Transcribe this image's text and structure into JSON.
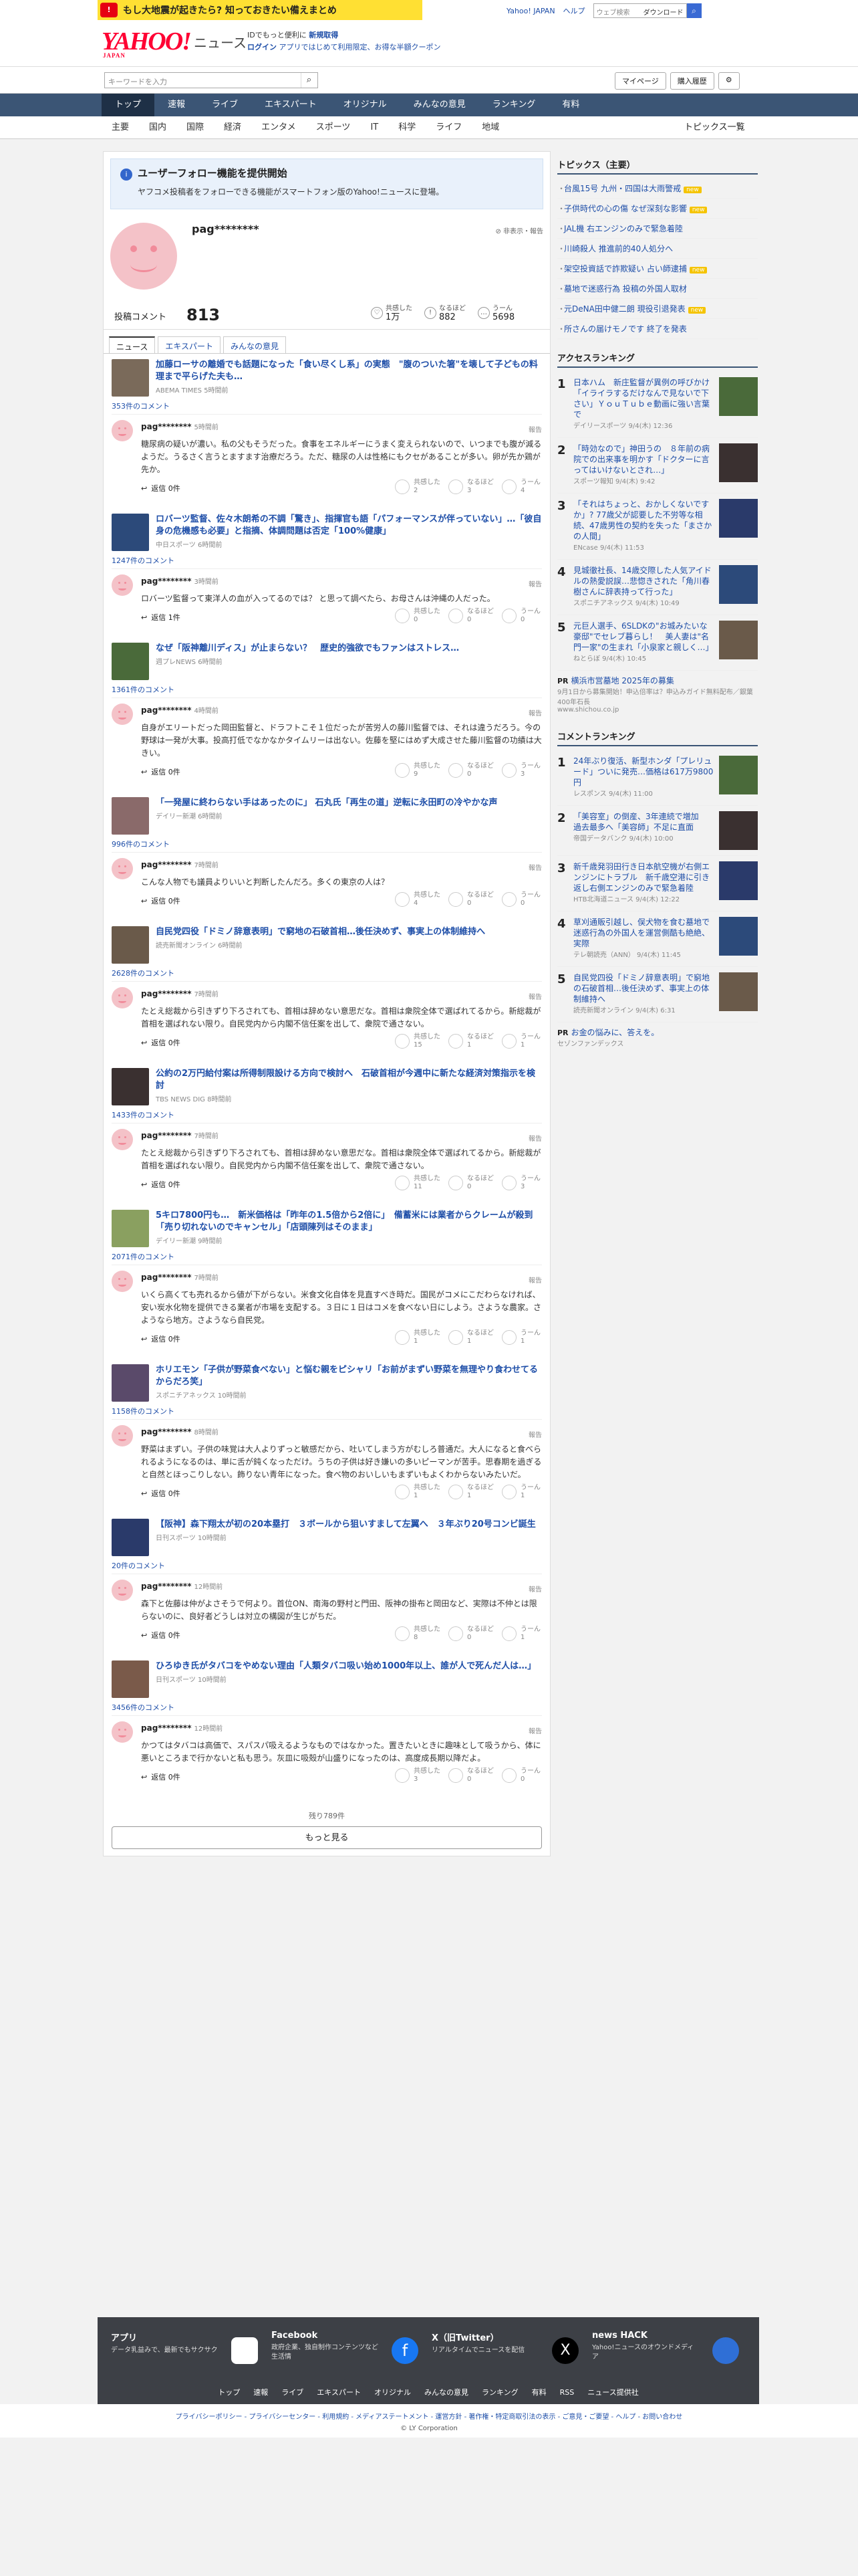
{
  "banner": {
    "text": "もし大地震が起きたら? 知っておきたい備えまとめ",
    "links": [
      "Yahoo! JAPAN",
      "ヘルプ"
    ],
    "search_placeholder": "ウェブ検索",
    "dl": "ダウンロード"
  },
  "header": {
    "logo": "YAHOO!",
    "logo_sub": "JAPAN",
    "service": "ニュース",
    "note1": "IDでもっと便利に",
    "note1b": "新規取得",
    "note2": "ログイン",
    "note3": "アプリではじめて利用限定、お得な半額クーポン"
  },
  "subbar": {
    "search_placeholder": "キーワードを入力",
    "mypage": "マイページ",
    "history": "購入履歴"
  },
  "nav": [
    "トップ",
    "速報",
    "ライブ",
    "エキスパート",
    "オリジナル",
    "みんなの意見",
    "ランキング",
    "有料"
  ],
  "nav2": [
    "主要",
    "国内",
    "国際",
    "経済",
    "エンタメ",
    "スポーツ",
    "IT",
    "科学",
    "ライフ",
    "地域"
  ],
  "nav2_right": "トピックス一覧",
  "notice": {
    "title": "ユーザーフォロー機能を提供開始",
    "desc": "ヤフコメ投稿者をフォローできる機能がスマートフォン版のYahoo!ニュースに登場。"
  },
  "profile": {
    "name": "pag********",
    "report": "非表示・報告",
    "comments_label": "投稿コメント",
    "comments_count": "813",
    "stats": [
      {
        "label": "共感した",
        "value": "1万"
      },
      {
        "label": "なるほど",
        "value": "882"
      },
      {
        "label": "うーん",
        "value": "5698"
      }
    ]
  },
  "tabs": [
    "ニュース",
    "エキスパート",
    "みんなの意見"
  ],
  "articles": [
    {
      "title": "加藤ローサの離婚でも話題になった「食い尽くし系」の実態　\"腹のついた箸\"を壊して子どもの料理まで平らげた夫も…",
      "src": "ABEMA TIMES 5時間前",
      "count": "353件のコメント",
      "time": "5時間前",
      "text": "糖尿病の疑いが濃い。私の父もそうだった。食事をエネルギーにうまく変えられないので、いつまでも腹が減るようだ。うるさく言うとますます治療だろう。ただ、糖尿の人は性格にもクセがあることが多い。卵が先か鶏が先か。",
      "reply": "返信 0件",
      "r": [
        "2",
        "3",
        "4"
      ]
    },
    {
      "title": "ロバーツ監督、佐々木朗希の不調「驚き」、指揮官も語「パフォーマンスが伴っていない」…「彼自身の危機感も必要」と指摘、体調問題は否定「100%健康」",
      "src": "中日スポーツ 6時間前",
      "count": "1247件のコメント",
      "time": "3時間前",
      "text": "ロバーツ監督って東洋人の血が入ってるのでは？ と思って調べたら、お母さんは沖縄の人だった。",
      "reply": "返信 1件",
      "r": [
        "0",
        "0",
        "0"
      ]
    },
    {
      "title": "なぜ「阪神離川ディス」が止まらない？　歴史的強欲でもファンはストレス…",
      "src": "週プレNEWS 6時間前",
      "count": "1361件のコメント",
      "time": "4時間前",
      "text": "自身がエリートだった岡田監督と、ドラフトこそ１位だったが苦労人の藤川監督では、それは違うだろう。今の野球は一発が大事。投高打低でなかなかタイムリーは出ない。佐藤を堅にはめず大成させた藤川監督の功績は大きい。",
      "reply": "返信 0件",
      "r": [
        "9",
        "0",
        "3"
      ]
    },
    {
      "title": "「一発屋に終わらない手はあったのに」 石丸氏「再生の道」逆転に永田町の冷やかな声",
      "src": "デイリー新潮 6時間前",
      "count": "996件のコメント",
      "time": "7時間前",
      "text": "こんな人物でも議員よりいいと判断したんだろ。多くの東京の人は？",
      "reply": "返信 0件",
      "r": [
        "4",
        "0",
        "0"
      ]
    },
    {
      "title": "自民党四役「ドミノ辞意表明」で窮地の石破首相…後任決めず、事実上の体制維持へ",
      "src": "読売新聞オンライン 6時間前",
      "count": "2628件のコメント",
      "time": "7時間前",
      "text": "たとえ総裁から引きずり下ろされても、首相は辞めない意思だな。首相は衆院全体で選ばれてるから。新総裁が首相を選ばれない限り。自民党内から内閣不信任案を出して、衆院で通さない。",
      "reply": "返信 0件",
      "r": [
        "15",
        "1",
        "1"
      ]
    },
    {
      "title": "公約の2万円給付案は所得制限設ける方向で検討へ　石破首相が今週中に新たな経済対策指示を検討",
      "src": "TBS NEWS DIG 8時間前",
      "count": "1433件のコメント",
      "time": "7時間前",
      "text": "たとえ総裁から引きずり下ろされても、首相は辞めない意思だな。首相は衆院全体で選ばれてるから。新総裁が首相を選ばれない限り。自民党内から内閣不信任案を出して、衆院で通さない。",
      "reply": "返信 0件",
      "r": [
        "11",
        "0",
        "3"
      ]
    },
    {
      "title": "5キロ7800円も…　新米価格は「昨年の1.5倍から2倍に」　備蓄米には業者からクレームが殺到「売り切れないのでキャンセル」「店頭陳列はそのまま」",
      "src": "デイリー新潮 9時間前",
      "count": "2071件のコメント",
      "time": "7時間前",
      "text": "いくら高くても売れるから値が下がらない。米食文化自体を見直すべき時だ。国民がコメにこだわらなければ、安い炭水化物を提供できる業者が市場を支配する。３日に１日はコメを食べない日にしよう。さような農家。さようなら地方。さようなら自民党。",
      "reply": "返信 0件",
      "r": [
        "1",
        "1",
        "1"
      ]
    },
    {
      "title": "ホリエモン「子供が野菜食べない」と悩む親をピシャリ「お前がまずい野菜を無理やり食わせてるからだろ笑」",
      "src": "スポニチアネックス 10時間前",
      "count": "1158件のコメント",
      "time": "8時間前",
      "text": "野菜はまずい。子供の味覚は大人よりずっと敏感だから、吐いてしまう方がむしろ普通だ。大人になると食べられるようになるのは、単に舌が鈍くなっただけ。うちの子供は好き嫌いの多いピーマンが苦手。思春期を過ぎると自然とほっこりしない。飾りない青年になった。食べ物のおいしいもまずいもよくわからないみたいだ。",
      "reply": "返信 0件",
      "r": [
        "1",
        "1",
        "1"
      ]
    },
    {
      "title": "【阪神】森下翔太が初の20本塁打　３ボールから狙いすまして左翼へ　３年ぶり20号コンビ誕生",
      "src": "日刊スポーツ 10時間前",
      "count": "20件のコメント",
      "time": "12時間前",
      "text": "森下と佐藤は仲がよさそうで何より。首位ON、南海の野村と門田、阪神の掛布と岡田など、実際は不仲とは限らないのに、良好者どうしは対立の構図が生じがちだ。",
      "reply": "返信 0件",
      "r": [
        "8",
        "0",
        "1"
      ]
    },
    {
      "title": "ひろゆき氏がタバコをやめない理由「人類タバコ吸い始め1000年以上、誰が人で死んだ人は…」",
      "src": "日刊スポーツ 10時間前",
      "count": "3456件のコメント",
      "time": "12時間前",
      "text": "かつてはタバコは高価で、スパスパ吸えるようなものではなかった。置きたいときに趣味として吸うから、体に悪いところまで行かないと私も思う。灰皿に吸殻が山盛りになったのは、高度成長期以降だよ。",
      "reply": "返信 0件",
      "r": [
        "3",
        "0",
        "0"
      ]
    }
  ],
  "more": {
    "remaining": "残り789件",
    "button": "もっと見る"
  },
  "side": {
    "topics_title": "トピックス（主要）",
    "topics": [
      {
        "t": "台風15号 九州・四国は大雨警戒",
        "n": "new"
      },
      {
        "t": "子供時代の心の傷 なぜ深刻な影響",
        "n": "new"
      },
      {
        "t": "JAL機 右エンジンのみで緊急着陸",
        "n": ""
      },
      {
        "t": "川崎殺人 推進前的40人処分へ",
        "n": ""
      },
      {
        "t": "架空投資話で詐欺疑い 占い師逮捕",
        "n": "new"
      },
      {
        "t": "墓地で迷惑行為 投稿の外国人取材",
        "n": ""
      },
      {
        "t": "元DeNA田中健二朗 現役引退発表",
        "n": "new"
      },
      {
        "t": "所さんの届けモノです 終了を発表",
        "n": ""
      }
    ],
    "access_title": "アクセスランキング",
    "access": [
      {
        "no": "1",
        "t": "日本ハム　新庄監督が異例の呼びかけ「イライラするだけなんで見ないで下さい」ＹｏｕＴｕｂｅ動画に強い言葉で",
        "s": "デイリースポーツ 9/4(木) 12:36"
      },
      {
        "no": "2",
        "t": "「時効なので」神田うの　８年前の病院での出来事を明かす「ドクターに言ってはいけないとされ…」",
        "s": "スポーツ報知 9/4(木) 9:42"
      },
      {
        "no": "3",
        "t": "「それはちょっと、おかしくないですか」? 77歳父が認要した不労等な相続、47歳男性の契約を失った「まさかの人間」",
        "s": "ENcase 9/4(木) 11:53"
      },
      {
        "no": "4",
        "t": "見城徹社長、14歳交際した人気アイドルの熱愛説誤…悲惚きされた「角川春樹さんに辞表持って行った」",
        "s": "スポニチアネックス 9/4(木) 10:49"
      },
      {
        "no": "5",
        "t": "元巨人選手、6SLDKの\"お城みたいな豪邸\"でセレブ暮らし！　美人妻は\"名門一家\"の生まれ「小泉家と親しく…」",
        "s": "ねとらぼ 9/4(木) 10:45"
      }
    ],
    "pr1": {
      "t": "横浜市営墓地 2025年の募集",
      "d": "9月1日から募集開始！申込倍率は？申込みガイド無料配布／銀葉400年石長",
      "s": "www.shichou.co.jp"
    },
    "comment_title": "コメントランキング",
    "comments": [
      {
        "no": "1",
        "t": "24年ぶり復活、新型ホンダ「プレリュード」ついに発売…価格は617万9800円",
        "s": "レスポンス 9/4(木) 11:00"
      },
      {
        "no": "2",
        "t": "「美容室」の倒産、3年連続で増加　過去最多へ「美容師」不足に直面",
        "s": "帝国データバンク 9/4(木) 10:00"
      },
      {
        "no": "3",
        "t": "新千歳発羽田行き日本航空機が右側エンジンにトラブル　新千歳空港に引き返し右側エンジンのみで緊急着陸",
        "s": "HTB北海道ニュース 9/4(木) 12:22"
      },
      {
        "no": "4",
        "t": "草刈通販引越し、俣犬物を食む墓地で迷惑行為の外国人を運営側酷も絶絶、実際",
        "s": "テレ朝読売（ANN） 9/4(木) 11:45"
      },
      {
        "no": "5",
        "t": "自民党四役「ドミノ辞意表明」で窮地の石破首相…後任決めず、事実上の体制維持へ",
        "s": "読売新聞オンライン 9/4(木) 6:31"
      }
    ],
    "pr2": {
      "t": "お金の悩みに、答えを。",
      "s": "セゾンファンデックス"
    }
  },
  "footer": {
    "items": [
      {
        "t": "アプリ",
        "d": "データ乳益みで、最新でもサクサク"
      },
      {
        "t": "Facebook",
        "d": "政府企業、独自制作コンテンツなど生活情"
      },
      {
        "t": "X（旧Twitter）",
        "d": "リアルタイムでニュースを配信"
      },
      {
        "t": "news HACK",
        "d": "Yahoo!ニュースのオウンドメディア"
      }
    ],
    "links": [
      "トップ",
      "速報",
      "ライブ",
      "エキスパート",
      "オリジナル",
      "みんなの意見",
      "ランキング",
      "有料",
      "RSS",
      "ニュース提供社"
    ],
    "legal": "プライバシーポリシー - プライバシーセンター - 利用規約 - メディアステートメント - 運営方針 - 著作権・特定商取引法の表示 - ご意見・ご要望 - ヘルプ - お問い合わせ",
    "copyright": "© LY Corporation"
  },
  "colors": {
    "link": "#1e4ea8",
    "nav": "#3b5575",
    "brand": "#ff0033",
    "avatar": "#f4c2c8"
  }
}
